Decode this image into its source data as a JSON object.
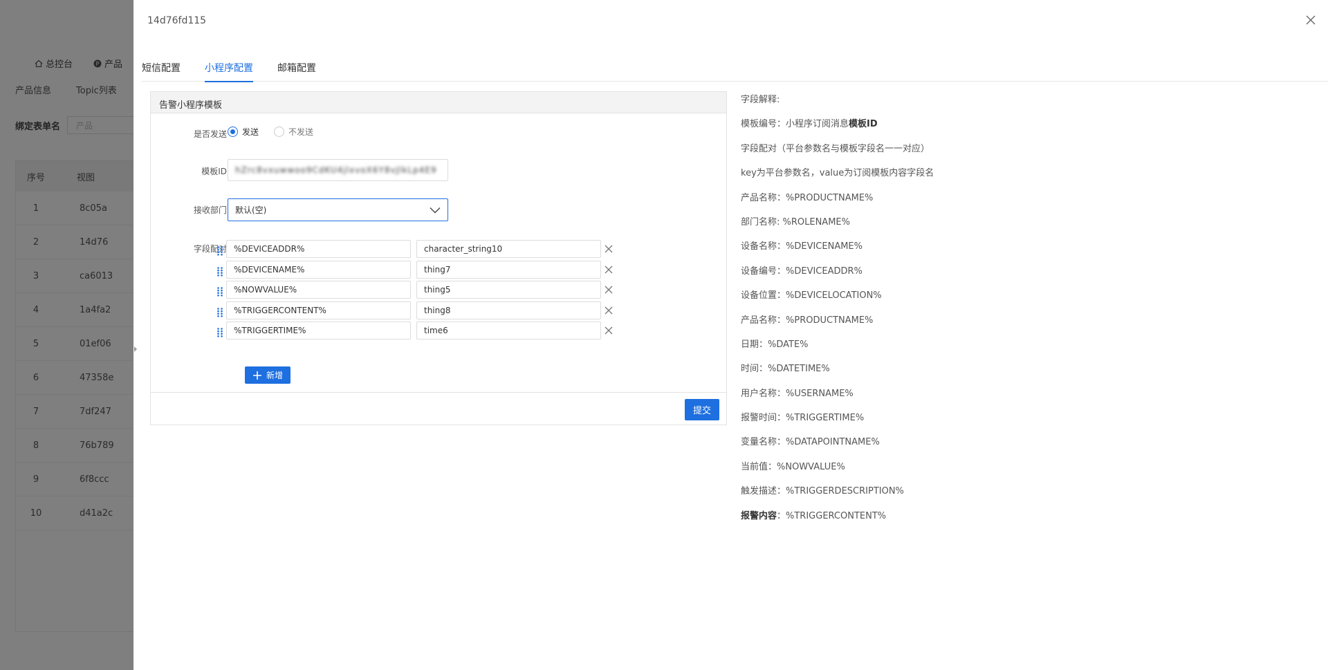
{
  "background": {
    "nav": [
      {
        "icon": "home-icon",
        "label": "总控台"
      },
      {
        "icon": "product-icon",
        "label": "产品"
      }
    ],
    "subtabs": [
      "产品信息",
      "Topic列表"
    ],
    "filter_label": "绑定表单名",
    "filter_placeholder": "产品",
    "table": {
      "headers": [
        "序号",
        "视图"
      ],
      "rows": [
        [
          "1",
          "8c05a"
        ],
        [
          "2",
          "14d76"
        ],
        [
          "3",
          "ca6013"
        ],
        [
          "4",
          "1a4fa2"
        ],
        [
          "5",
          "01ef06"
        ],
        [
          "6",
          "47358e"
        ],
        [
          "7",
          "7df247"
        ],
        [
          "8",
          "76b789"
        ],
        [
          "9",
          "6f8ccc"
        ],
        [
          "10",
          "d41a2c"
        ]
      ]
    }
  },
  "drawer": {
    "title": "14d76fd115",
    "tabs": [
      {
        "label": "短信配置",
        "active": false
      },
      {
        "label": "小程序配置",
        "active": true
      },
      {
        "label": "邮箱配置",
        "active": false
      }
    ],
    "card": {
      "title": "告警小程序模板",
      "send_label": "是否发送",
      "send_options": [
        {
          "label": "发送",
          "checked": true
        },
        {
          "label": "不发送",
          "checked": false
        }
      ],
      "template_id_label": "模板ID",
      "template_id_value": "hZrc8vxuwwoo9CdKU4jlxvoX6Y8vJlkLp4E9",
      "dept_label": "接收部门",
      "dept_value": "默认(空)",
      "mapping_label": "字段配对",
      "mappings": [
        {
          "key": "%DEVICEADDR%",
          "value": "character_string10"
        },
        {
          "key": "%DEVICENAME%",
          "value": "thing7"
        },
        {
          "key": "%NOWVALUE%",
          "value": "thing5"
        },
        {
          "key": "%TRIGGERCONTENT%",
          "value": "thing8"
        },
        {
          "key": "%TRIGGERTIME%",
          "value": "time6"
        }
      ],
      "add_label": "新增",
      "submit_label": "提交"
    },
    "help": {
      "lines": [
        {
          "text": "字段解释:"
        },
        {
          "text": "模板编号：小程序订阅消息",
          "bold": "模板ID"
        },
        {
          "text": "字段配对（平台参数名与模板字段名一一对应）"
        },
        {
          "text": "key为平台参数名，value为订阅模板内容字段名"
        },
        {
          "text": "产品名称：%PRODUCTNAME%"
        },
        {
          "text": "部门名称: %ROLENAME%"
        },
        {
          "text": "设备名称：%DEVICENAME%"
        },
        {
          "text": "设备编号：%DEVICEADDR%"
        },
        {
          "text": "设备位置：%DEVICELOCATION%"
        },
        {
          "text": "产品名称：%PRODUCTNAME%"
        },
        {
          "text": "日期：%DATE%"
        },
        {
          "text": "时间：%DATETIME%"
        },
        {
          "text": "用户名称：%USERNAME%"
        },
        {
          "text": "报警时间：%TRIGGERTIME%"
        },
        {
          "text": "变量名称：%DATAPOINTNAME%"
        },
        {
          "text": "当前值：%NOWVALUE%"
        },
        {
          "text": "触发描述：%TRIGGERDESCRIPTION%"
        },
        {
          "text": "：%TRIGGERCONTENT%",
          "bold_prefix": "报警内容"
        }
      ]
    }
  },
  "colors": {
    "accent": "#1e6fe0",
    "overlay": "rgba(0,0,0,0.5)"
  }
}
